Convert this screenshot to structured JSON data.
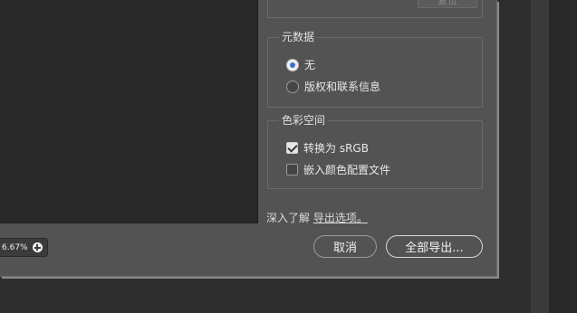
{
  "preview": {
    "zoom_label": "6.67%",
    "zoom_icon": "plus-circle-icon"
  },
  "top_panel": {
    "reset_label": "复位"
  },
  "metadata": {
    "title": "元数据",
    "options": [
      {
        "label": "无",
        "selected": true
      },
      {
        "label": "版权和联系信息",
        "selected": false
      }
    ]
  },
  "colorspace": {
    "title": "色彩空间",
    "options": [
      {
        "label": "转换为 sRGB",
        "checked": true
      },
      {
        "label": "嵌入颜色配置文件",
        "checked": false
      }
    ]
  },
  "footer": {
    "learn_prefix": "深入了解",
    "learn_link": "导出选项。",
    "cancel_label": "取消",
    "export_all_label": "全部导出..."
  },
  "colors": {
    "dialog_bg": "#535353",
    "preview_bg": "#282828",
    "radio_accent": "#3d6fd6"
  }
}
